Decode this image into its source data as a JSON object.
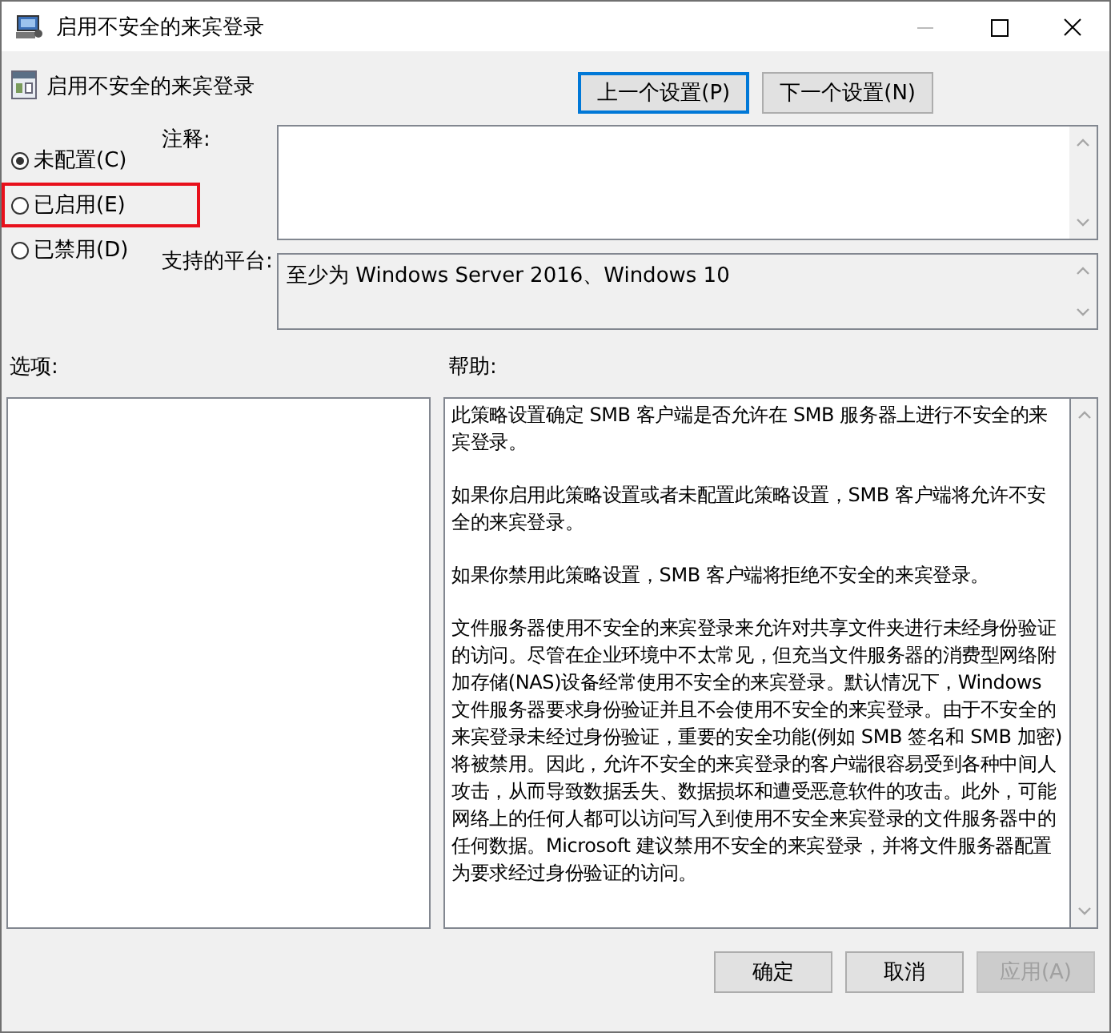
{
  "window": {
    "title": "启用不安全的来宾登录"
  },
  "policy": {
    "title": "启用不安全的来宾登录"
  },
  "nav_buttons": [
    {
      "label": "上一个设置(P)",
      "focused": true
    },
    {
      "label": "下一个设置(N)",
      "focused": false
    }
  ],
  "state_options": [
    {
      "label": "未配置(C)",
      "selected": true,
      "highlighted": false
    },
    {
      "label": "已启用(E)",
      "selected": false,
      "highlighted": true
    },
    {
      "label": "已禁用(D)",
      "selected": false,
      "highlighted": false
    }
  ],
  "comment": {
    "label": "注释:"
  },
  "platform": {
    "label": "支持的平台:",
    "value": "至少为 Windows Server 2016、Windows 10"
  },
  "options_label": "选项:",
  "help_label": "帮助:",
  "help_paragraphs": [
    "此策略设置确定 SMB 客户端是否允许在 SMB 服务器上进行不安全的来宾登录。",
    "如果你启用此策略设置或者未配置此策略设置，SMB 客户端将允许不安全的来宾登录。",
    "如果你禁用此策略设置，SMB 客户端将拒绝不安全的来宾登录。",
    "文件服务器使用不安全的来宾登录来允许对共享文件夹进行未经身份验证的访问。尽管在企业环境中不太常见，但充当文件服务器的消费型网络附加存储(NAS)设备经常使用不安全的来宾登录。默认情况下，Windows 文件服务器要求身份验证并且不会使用不安全的来宾登录。由于不安全的来宾登录未经过身份验证，重要的安全功能(例如 SMB 签名和 SMB 加密)将被禁用。因此，允许不安全的来宾登录的客户端很容易受到各种中间人攻击，从而导致数据丢失、数据损坏和遭受恶意软件的攻击。此外，可能网络上的任何人都可以访问写入到使用不安全来宾登录的文件服务器中的任何数据。Microsoft 建议禁用不安全的来宾登录，并将文件服务器配置为要求经过身份验证的访问。"
  ],
  "footer_buttons": [
    {
      "label": "确定",
      "disabled": false
    },
    {
      "label": "取消",
      "disabled": false
    },
    {
      "label": "应用(A)",
      "disabled": true
    }
  ]
}
